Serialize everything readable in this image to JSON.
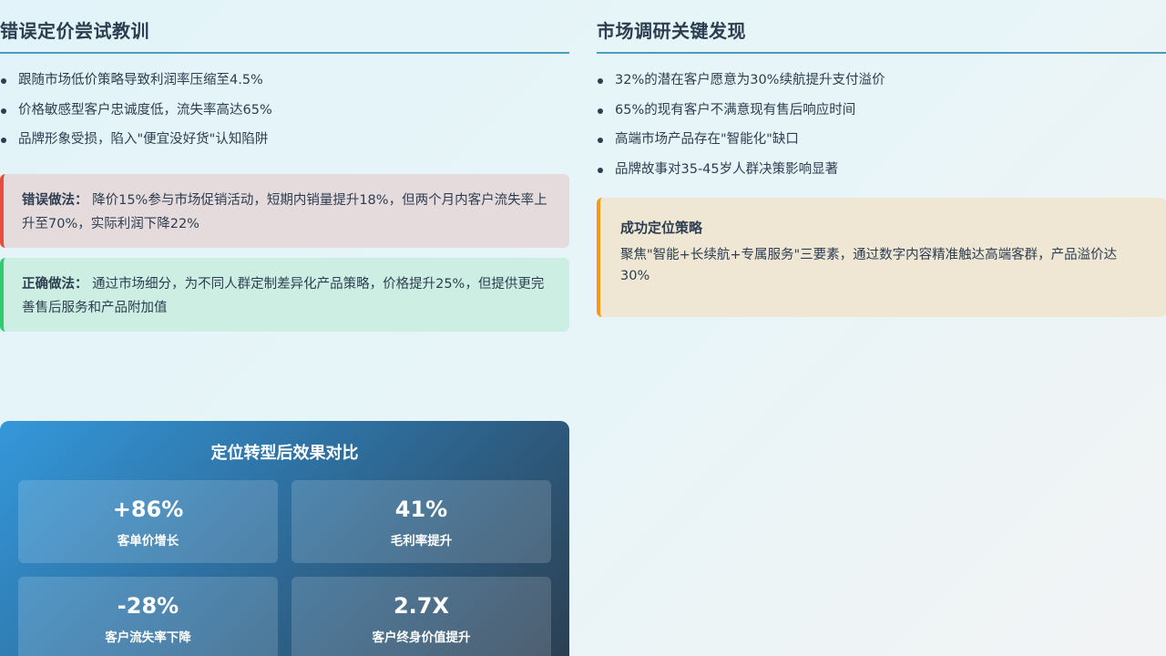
{
  "left": {
    "title": "错误定价尝试教训",
    "bullets": [
      "跟随市场低价策略导致利润率压缩至4.5%",
      "价格敏感型客户忠诚度低，流失率高达65%",
      "品牌形象受损，陷入\"便宜没好货\"认知陷阱"
    ],
    "bad": {
      "label": "错误做法：",
      "text": "降价15%参与市场促销活动，短期内销量提升18%，但两个月内客户流失率上升至70%，实际利润下降22%"
    },
    "good": {
      "label": "正确做法：",
      "text": "通过市场细分，为不同人群定制差异化产品策略，价格提升25%，但提供更完善售后服务和产品附加值"
    }
  },
  "right": {
    "title": "市场调研关键发现",
    "bullets": [
      "32%的潜在客户愿意为30%续航提升支付溢价",
      "65%的现有客户不满意现有售后响应时间",
      "高端市场产品存在\"智能化\"缺口",
      "品牌故事对35-45岁人群决策影响显著"
    ],
    "strategy": {
      "title": "成功定位策略",
      "text": "聚焦\"智能+长续航+专属服务\"三要素，通过数字内容精准触达高端客群，产品溢价达30%"
    }
  },
  "panel": {
    "title": "定位转型后效果对比",
    "metrics": [
      {
        "value": "+86%",
        "label": "客单价增长"
      },
      {
        "value": "41%",
        "label": "毛利率提升"
      },
      {
        "value": "-28%",
        "label": "客户流失率下降"
      },
      {
        "value": "2.7X",
        "label": "客户终身价值提升"
      }
    ]
  },
  "colors": {
    "heading": "#2c3e50",
    "divider": "#4a9bbd",
    "bad_accent": "#e74c3c",
    "good_accent": "#2ecc71",
    "gold_accent": "#f39c12"
  }
}
